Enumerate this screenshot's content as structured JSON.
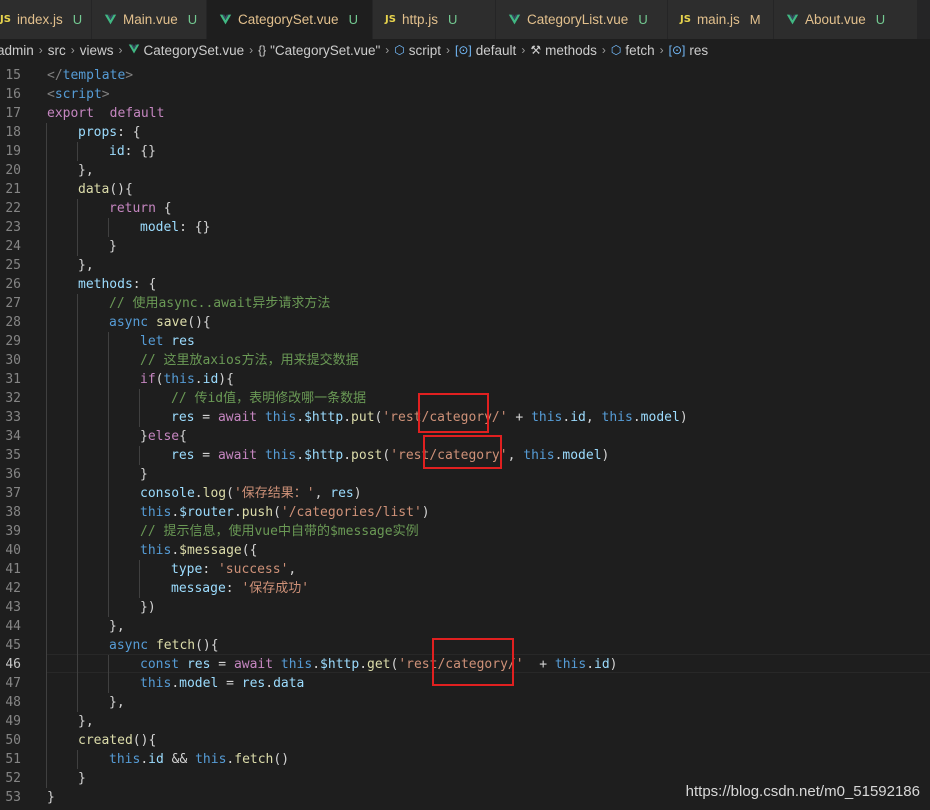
{
  "tabs": [
    {
      "name": "index.js",
      "type": "js",
      "badge": "U"
    },
    {
      "name": "Main.vue",
      "type": "vue",
      "badge": "U"
    },
    {
      "name": "CategorySet.vue",
      "type": "vue",
      "badge": "U",
      "active": true,
      "dirty": true
    },
    {
      "name": "http.js",
      "type": "js",
      "badge": "U"
    },
    {
      "name": "CategoryList.vue",
      "type": "vue",
      "badge": "U"
    },
    {
      "name": "main.js",
      "type": "js",
      "badge": "M"
    },
    {
      "name": "About.vue",
      "type": "vue",
      "badge": "U"
    }
  ],
  "js_icon_text": "JS",
  "breadcrumb": [
    {
      "label": "admin",
      "icon": null
    },
    {
      "label": "src",
      "icon": null
    },
    {
      "label": "views",
      "icon": null
    },
    {
      "label": "CategorySet.vue",
      "icon": "vue-icon"
    },
    {
      "label": "\"CategorySet.vue\"",
      "icon": "braces-icon"
    },
    {
      "label": "script",
      "icon": "cube-icon"
    },
    {
      "label": "default",
      "icon": "variable-icon"
    },
    {
      "label": "methods",
      "icon": "wrench-icon"
    },
    {
      "label": "fetch",
      "icon": "cube-icon"
    },
    {
      "label": "res",
      "icon": "variable-icon"
    }
  ],
  "current_line": 46,
  "lines": [
    {
      "n": 15,
      "d": 0,
      "tokens": [
        [
          "t",
          "</"
        ],
        [
          "tg",
          "template"
        ],
        [
          "t",
          ">"
        ]
      ]
    },
    {
      "n": 16,
      "d": 0,
      "tokens": [
        [
          "t",
          "<"
        ],
        [
          "tg",
          "script"
        ],
        [
          "t",
          ">"
        ]
      ]
    },
    {
      "n": 17,
      "d": 0,
      "tokens": [
        [
          "k",
          "export"
        ],
        [
          "",
          "  "
        ],
        [
          "k",
          "default"
        ],
        [
          "",
          "",
          " {"
        ]
      ]
    },
    {
      "n": 18,
      "d": 1,
      "tokens": [
        [
          "v",
          "props"
        ],
        [
          "",
          ": {"
        ]
      ]
    },
    {
      "n": 19,
      "d": 2,
      "tokens": [
        [
          "v",
          "id"
        ],
        [
          "",
          ": {}"
        ]
      ]
    },
    {
      "n": 20,
      "d": 1,
      "tokens": [
        [
          "",
          "},"
        ]
      ]
    },
    {
      "n": 21,
      "d": 1,
      "tokens": [
        [
          "f",
          "data"
        ],
        [
          "",
          "(){"
        ]
      ]
    },
    {
      "n": 22,
      "d": 2,
      "tokens": [
        [
          "k",
          "return"
        ],
        [
          "",
          " {"
        ]
      ]
    },
    {
      "n": 23,
      "d": 3,
      "tokens": [
        [
          "v",
          "model"
        ],
        [
          "",
          ": {}"
        ]
      ]
    },
    {
      "n": 24,
      "d": 2,
      "tokens": [
        [
          "",
          "}"
        ]
      ]
    },
    {
      "n": 25,
      "d": 1,
      "tokens": [
        [
          "",
          "},"
        ]
      ]
    },
    {
      "n": 26,
      "d": 1,
      "tokens": [
        [
          "v",
          "methods"
        ],
        [
          "",
          ": {"
        ]
      ]
    },
    {
      "n": 27,
      "d": 2,
      "tokens": [
        [
          "c",
          "// 使用async..await异步请求方法"
        ]
      ]
    },
    {
      "n": 28,
      "d": 2,
      "tokens": [
        [
          "b",
          "async"
        ],
        [
          "",
          ""
        ],
        [
          "f",
          " save"
        ],
        [
          "",
          "(){"
        ]
      ]
    },
    {
      "n": 29,
      "d": 3,
      "tokens": [
        [
          "b",
          "let"
        ],
        [
          "v",
          " res"
        ]
      ]
    },
    {
      "n": 30,
      "d": 3,
      "tokens": [
        [
          "c",
          "// 这里放axios方法，用来提交数据"
        ]
      ]
    },
    {
      "n": 31,
      "d": 3,
      "tokens": [
        [
          "k",
          "if"
        ],
        [
          "",
          "("
        ],
        [
          "b",
          "this"
        ],
        [
          "",
          "."
        ],
        [
          "v",
          "id"
        ],
        [
          "",
          "){"
        ]
      ]
    },
    {
      "n": 32,
      "d": 4,
      "tokens": [
        [
          "c",
          "// 传id值，表明修改哪一条数据"
        ]
      ]
    },
    {
      "n": 33,
      "d": 4,
      "tokens": [
        [
          "v",
          "res"
        ],
        [
          "",
          " = "
        ],
        [
          "k",
          "await"
        ],
        [
          "",
          " "
        ],
        [
          "b",
          "this"
        ],
        [
          "",
          "."
        ],
        [
          "v",
          "$http"
        ],
        [
          "",
          "."
        ],
        [
          "f",
          "put"
        ],
        [
          "",
          "("
        ],
        [
          "s",
          "'rest/category/'"
        ],
        [
          "",
          " + "
        ],
        [
          "b",
          "this"
        ],
        [
          "",
          "."
        ],
        [
          "v",
          "id"
        ],
        [
          "",
          ", "
        ],
        [
          "b",
          "this"
        ],
        [
          "",
          "."
        ],
        [
          "v",
          "model"
        ],
        [
          "",
          ")"
        ]
      ]
    },
    {
      "n": 34,
      "d": 3,
      "tokens": [
        [
          "",
          "}"
        ],
        [
          "k",
          "else"
        ],
        [
          "",
          "{"
        ]
      ]
    },
    {
      "n": 35,
      "d": 4,
      "tokens": [
        [
          "v",
          "res"
        ],
        [
          "",
          " = "
        ],
        [
          "k",
          "await"
        ],
        [
          "",
          " "
        ],
        [
          "b",
          "this"
        ],
        [
          "",
          "."
        ],
        [
          "v",
          "$http"
        ],
        [
          "",
          "."
        ],
        [
          "f",
          "post"
        ],
        [
          "",
          "("
        ],
        [
          "s",
          "'rest/category'"
        ],
        [
          "",
          ", "
        ],
        [
          "b",
          "this"
        ],
        [
          "",
          "."
        ],
        [
          "v",
          "model"
        ],
        [
          "",
          ")"
        ]
      ]
    },
    {
      "n": 36,
      "d": 3,
      "tokens": [
        [
          "",
          "}"
        ]
      ]
    },
    {
      "n": 37,
      "d": 3,
      "tokens": [
        [
          "v",
          "console"
        ],
        [
          "",
          "."
        ],
        [
          "f",
          "log"
        ],
        [
          "",
          "("
        ],
        [
          "s",
          "'保存结果：'"
        ],
        [
          "",
          ", "
        ],
        [
          "v",
          "res"
        ],
        [
          "",
          ")"
        ]
      ]
    },
    {
      "n": 38,
      "d": 3,
      "tokens": [
        [
          "b",
          "this"
        ],
        [
          "",
          "."
        ],
        [
          "v",
          "$router"
        ],
        [
          "",
          "."
        ],
        [
          "f",
          "push"
        ],
        [
          "",
          "("
        ],
        [
          "s",
          "'/categories/list'"
        ],
        [
          "",
          ")"
        ]
      ]
    },
    {
      "n": 39,
      "d": 3,
      "tokens": [
        [
          "c",
          "// 提示信息，使用vue中自带的$message实例"
        ]
      ]
    },
    {
      "n": 40,
      "d": 3,
      "tokens": [
        [
          "b",
          "this"
        ],
        [
          "",
          "."
        ],
        [
          "f",
          "$message"
        ],
        [
          "",
          "({"
        ]
      ]
    },
    {
      "n": 41,
      "d": 4,
      "tokens": [
        [
          "v",
          "type"
        ],
        [
          "",
          ": "
        ],
        [
          "s",
          "'success'"
        ],
        [
          "",
          ","
        ]
      ]
    },
    {
      "n": 42,
      "d": 4,
      "tokens": [
        [
          "v",
          "message"
        ],
        [
          "",
          ": "
        ],
        [
          "s",
          "'保存成功'"
        ]
      ]
    },
    {
      "n": 43,
      "d": 3,
      "tokens": [
        [
          "",
          "})"
        ]
      ]
    },
    {
      "n": 44,
      "d": 2,
      "tokens": [
        [
          "",
          "},"
        ]
      ]
    },
    {
      "n": 45,
      "d": 2,
      "tokens": [
        [
          "b",
          "async"
        ],
        [
          "f",
          " fetch"
        ],
        [
          "",
          "(){"
        ]
      ]
    },
    {
      "n": 46,
      "d": 3,
      "tokens": [
        [
          "b",
          "const"
        ],
        [
          "v",
          " res"
        ],
        [
          "",
          " = "
        ],
        [
          "k",
          "await"
        ],
        [
          "",
          " "
        ],
        [
          "b",
          "this"
        ],
        [
          "",
          "."
        ],
        [
          "v",
          "$http"
        ],
        [
          "",
          "."
        ],
        [
          "f",
          "get"
        ],
        [
          "",
          "("
        ],
        [
          "s",
          "'rest/category/'"
        ],
        [
          "",
          "  + "
        ],
        [
          "b",
          "this"
        ],
        [
          "",
          "."
        ],
        [
          "v",
          "id"
        ],
        [
          "",
          ")"
        ]
      ]
    },
    {
      "n": 47,
      "d": 3,
      "tokens": [
        [
          "b",
          "this"
        ],
        [
          "",
          "."
        ],
        [
          "v",
          "model"
        ],
        [
          "",
          " = "
        ],
        [
          "v",
          "res"
        ],
        [
          "",
          "."
        ],
        [
          "v",
          "data"
        ]
      ]
    },
    {
      "n": 48,
      "d": 2,
      "tokens": [
        [
          "",
          "},"
        ]
      ]
    },
    {
      "n": 49,
      "d": 1,
      "tokens": [
        [
          "",
          "},"
        ]
      ]
    },
    {
      "n": 50,
      "d": 1,
      "tokens": [
        [
          "f",
          "created"
        ],
        [
          "",
          "(){"
        ]
      ]
    },
    {
      "n": 51,
      "d": 2,
      "tokens": [
        [
          "b",
          "this"
        ],
        [
          "",
          "."
        ],
        [
          "v",
          "id"
        ],
        [
          "",
          " && "
        ],
        [
          "b",
          "this"
        ],
        [
          "",
          "."
        ],
        [
          "f",
          "fetch"
        ],
        [
          "",
          "()"
        ]
      ]
    },
    {
      "n": 52,
      "d": 1,
      "tokens": [
        [
          "",
          "}"
        ]
      ]
    },
    {
      "n": 53,
      "d": 0,
      "tokens": [
        [
          "",
          "}"
        ]
      ]
    }
  ],
  "watermark": "https://blog.csdn.net/m0_51592186"
}
